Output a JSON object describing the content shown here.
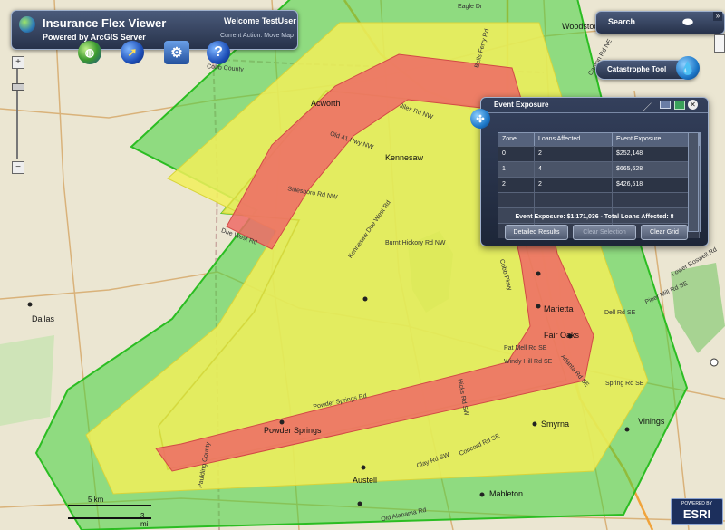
{
  "app": {
    "title": "Insurance Flex Viewer",
    "subtitle": "Powered by ArcGIS Server",
    "welcome": "Welcome TestUser",
    "current_action": "Current Action: Move Map"
  },
  "search": {
    "label": "Search"
  },
  "catastrophe": {
    "label": "Catastrophe Tool"
  },
  "event_panel": {
    "title": "Event Exposure",
    "columns": [
      "Zone",
      "Loans Affected",
      "Event Exposure"
    ],
    "rows": [
      [
        "0",
        "2",
        "$252,148"
      ],
      [
        "1",
        "4",
        "$665,628"
      ],
      [
        "2",
        "2",
        "$426,518"
      ]
    ],
    "summary": "Event Exposure: $1,171,036 - Total Loans Affected: 8",
    "buttons": {
      "detailed": "Detailed Results",
      "clear_selection": "Clear Selection",
      "clear_grid": "Clear Grid"
    }
  },
  "map_labels": {
    "cities": [
      "Acworth",
      "Kennesaw",
      "Marietta",
      "Fair Oaks",
      "Smyrna",
      "Powder Springs",
      "Austell",
      "Mableton",
      "Vinings",
      "Dallas",
      "Woodstock"
    ],
    "roads": [
      "Due West Rd",
      "Stilesboro Rd NW",
      "Jiles Rd NW",
      "Burnt Hickory Rd NW",
      "Pat Mell Rd SE",
      "Windy Hill Rd SE",
      "Clay Rd SW",
      "Concord Rd SE",
      "Old Alabama Rd",
      "Powder Springs Rd",
      "Atlanta Rd SE",
      "Spring Rd SE",
      "Dell Rd SE",
      "Lower Roswell Rd",
      "Piper Mill Rd SE",
      "Cobb County",
      "Paulding County",
      "Hicks Rd SW",
      "Old 41 Hwy NW",
      "Canton Rd NE",
      "Eagle Dr",
      "Kennesaw Due West Rd",
      "Bells Ferry Rd",
      "Cobb Pkwy"
    ],
    "scale_km": "5 km",
    "scale_mi": "3 mi"
  },
  "esri": {
    "powered": "POWERED BY",
    "name": "ESRI"
  },
  "colors": {
    "green": "#44d23c",
    "yellow": "#f2ee5a",
    "red": "#ee6a66"
  }
}
